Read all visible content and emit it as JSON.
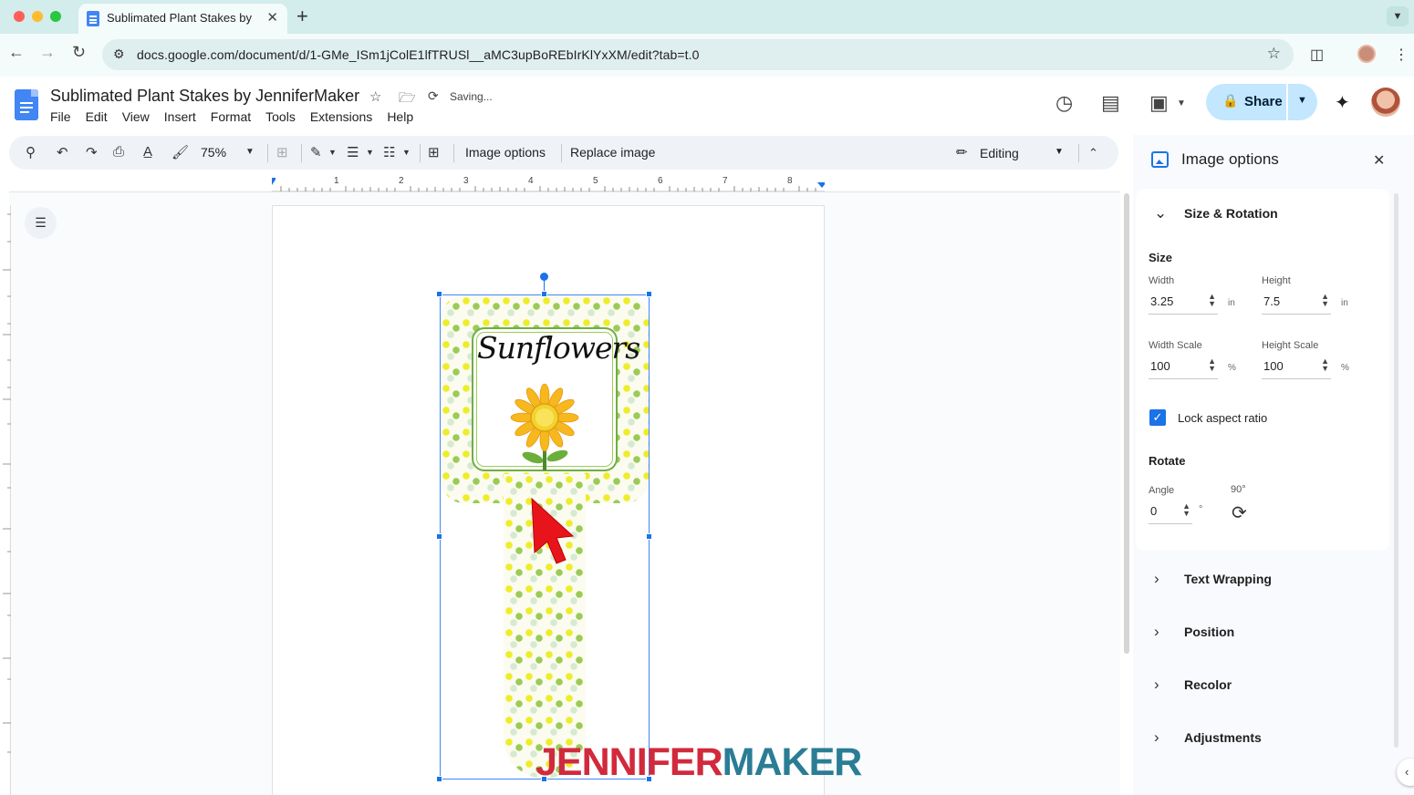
{
  "browser": {
    "tab_title": "Sublimated Plant Stakes by J",
    "tab_close": "✕",
    "new_tab": "+",
    "url": "docs.google.com/document/d/1-GMe_ISm1jColE1lfTRUSl__aMC3upBoREbIrKlYxXM/edit?tab=t.0",
    "traffic_colors": [
      "#ff5f57",
      "#febc2e",
      "#28c840"
    ]
  },
  "docs": {
    "title": "Sublimated Plant Stakes by JenniferMaker",
    "status": "Saving...",
    "menu": [
      "File",
      "Edit",
      "View",
      "Insert",
      "Format",
      "Tools",
      "Extensions",
      "Help"
    ],
    "share_label": "Share"
  },
  "toolbar": {
    "zoom": "75%",
    "image_options": "Image options",
    "replace_image": "Replace image",
    "mode": "Editing"
  },
  "ruler": {
    "numbers": [
      "1",
      "2",
      "3",
      "4",
      "5",
      "6",
      "7",
      "8"
    ]
  },
  "image": {
    "label_text": "Sunflowers",
    "watermark_a": "JENNIFER",
    "watermark_b": "MAKER"
  },
  "panel": {
    "title": "Image options",
    "sections": {
      "size_rotation": "Size & Rotation",
      "text_wrapping": "Text Wrapping",
      "position": "Position",
      "recolor": "Recolor",
      "adjustments": "Adjustments"
    },
    "size": {
      "heading": "Size",
      "width_label": "Width",
      "width_value": "3.25",
      "width_unit": "in",
      "height_label": "Height",
      "height_value": "7.5",
      "height_unit": "in",
      "width_scale_label": "Width Scale",
      "width_scale_value": "100",
      "width_scale_unit": "%",
      "height_scale_label": "Height Scale",
      "height_scale_value": "100",
      "height_scale_unit": "%",
      "lock_label": "Lock aspect ratio",
      "lock_checked": true
    },
    "rotate": {
      "heading": "Rotate",
      "angle_label": "Angle",
      "angle_value": "0",
      "angle_unit": "°",
      "rotate90_label": "90°"
    }
  },
  "colors": {
    "accent": "#1a73e8",
    "share_bg": "#c2e7ff",
    "tabbar": "#d3ecec"
  }
}
